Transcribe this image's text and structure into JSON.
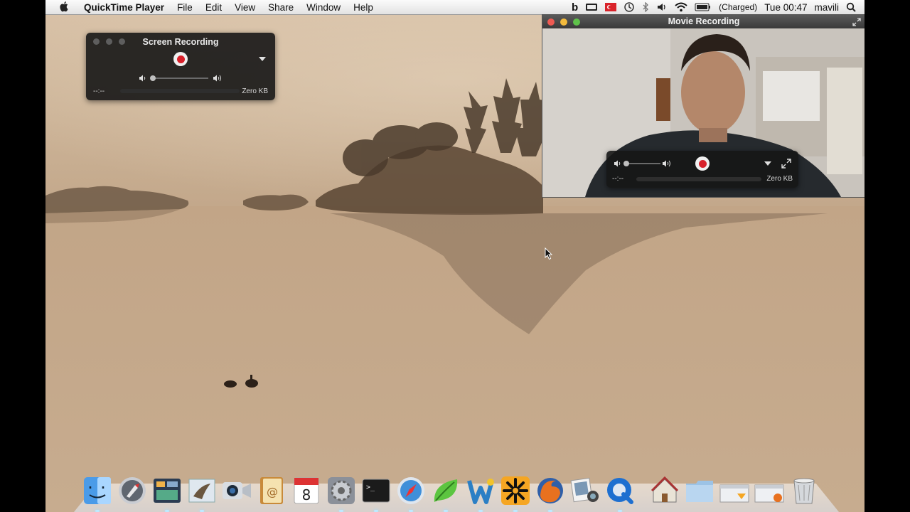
{
  "menubar": {
    "app_name": "QuickTime Player",
    "menus": [
      "File",
      "Edit",
      "View",
      "Share",
      "Window",
      "Help"
    ],
    "battery_status": "(Charged)",
    "clock": "Tue 00:47",
    "user": "mavili"
  },
  "screen_recording": {
    "title": "Screen Recording",
    "time": "--:--",
    "size": "Zero KB",
    "volume": 0.0
  },
  "movie_recording": {
    "title": "Movie Recording",
    "time": "--:--",
    "size": "Zero KB",
    "volume": 0.0
  },
  "dock": {
    "items": [
      "finder-icon",
      "launchpad-icon",
      "mission-control-icon",
      "mail-icon",
      "facetime-icon",
      "address-book-icon",
      "calendar-icon",
      "system-preferences-icon",
      "terminal-icon",
      "safari-icon",
      "leaf-app-icon",
      "wunderlist-icon",
      "spark-app-icon",
      "firefox-icon",
      "photo-booth-icon",
      "quicktime-icon",
      "home-folder-icon",
      "documents-folder-icon",
      "downloads-stack-icon",
      "applications-stack-icon",
      "trash-icon"
    ],
    "calendar_day": "8"
  },
  "colors": {
    "record_red": "#d8202a",
    "hud_bg": "#161616",
    "close_red": "#ee5a52",
    "minimize_yellow": "#f4bb3d",
    "zoom_green": "#5fc24a"
  }
}
